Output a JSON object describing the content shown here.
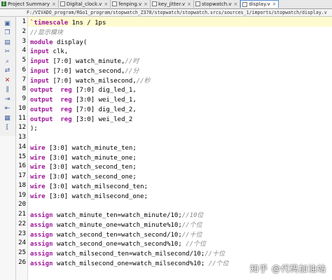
{
  "tabs": [
    {
      "label": "Project Summary",
      "icon": "summary",
      "active": false,
      "has_close": true
    },
    {
      "label": "Digital_clock.v",
      "icon": "verilog",
      "active": false,
      "has_close": true
    },
    {
      "label": "fenping.v",
      "icon": "verilog",
      "active": false,
      "has_close": true
    },
    {
      "label": "key_jitter.v",
      "icon": "verilog",
      "active": false,
      "has_close": true
    },
    {
      "label": "stopwatch.v",
      "icon": "verilog",
      "active": false,
      "has_close": true
    },
    {
      "label": "display.v",
      "icon": "verilog",
      "active": true,
      "has_close": true
    }
  ],
  "path": "F:/VIVADO_program/RGo1_program/stopwatch_Z378/stopwatch/stopwatch.srcs/sources_1/imports/stopwatch/display.v",
  "toolbar_icons": [
    "save-icon",
    "copy-icon",
    "paste-icon",
    "cut-icon",
    "find-icon",
    "replace-icon",
    "delete-icon",
    "comment-icon",
    "indent-icon",
    "outdent-icon",
    "format-icon",
    "bracket-icon"
  ],
  "close_glyph": "×",
  "code": [
    {
      "n": "1",
      "text": "`timescale 1ns / 1ps"
    },
    {
      "n": "2",
      "text": "//显示模块"
    },
    {
      "n": "3",
      "text": "module display("
    },
    {
      "n": "4",
      "text": "input clk,"
    },
    {
      "n": "5",
      "text": "input [7:0] watch_minute,//时"
    },
    {
      "n": "6",
      "text": "input [7:0] watch_second,//分"
    },
    {
      "n": "7",
      "text": "input [7:0] watch_milsecond,//秒"
    },
    {
      "n": "8",
      "text": "output  reg [7:0] dig_led_1,"
    },
    {
      "n": "9",
      "text": "output  reg [3:0] wei_led_1,"
    },
    {
      "n": "10",
      "text": "output  reg [7:0] dig_led_2,"
    },
    {
      "n": "11",
      "text": "output  reg [3:0] wei_led_2"
    },
    {
      "n": "12",
      "text": ");"
    },
    {
      "n": "13",
      "text": ""
    },
    {
      "n": "14",
      "text": "wire [3:0] watch_minute_ten;"
    },
    {
      "n": "15",
      "text": "wire [3:0] watch_minute_one;"
    },
    {
      "n": "16",
      "text": "wire [3:0] watch_second_ten;"
    },
    {
      "n": "17",
      "text": "wire [3:0] watch_second_one;"
    },
    {
      "n": "18",
      "text": "wire [3:0] watch_milsecond_ten;"
    },
    {
      "n": "19",
      "text": "wire [3:0] watch_milsecond_one;"
    },
    {
      "n": "20",
      "text": ""
    },
    {
      "n": "21",
      "text": "assign watch_minute_ten=watch_minute/10;//10位"
    },
    {
      "n": "22",
      "text": "assign watch_minute_one=watch_minute%10;//个位"
    },
    {
      "n": "23",
      "text": "assign watch_second_ten=watch_second/10;//十位"
    },
    {
      "n": "24",
      "text": "assign watch_second_one=watch_second%10; //个位"
    },
    {
      "n": "25",
      "text": "assign watch_milsecond_ten=watch_milsecond/10;//十位"
    },
    {
      "n": "26",
      "text": "assign watch_milsecond_one=watch_milsecond%10; //个位"
    }
  ],
  "watermark": "知乎 @代码加油站"
}
